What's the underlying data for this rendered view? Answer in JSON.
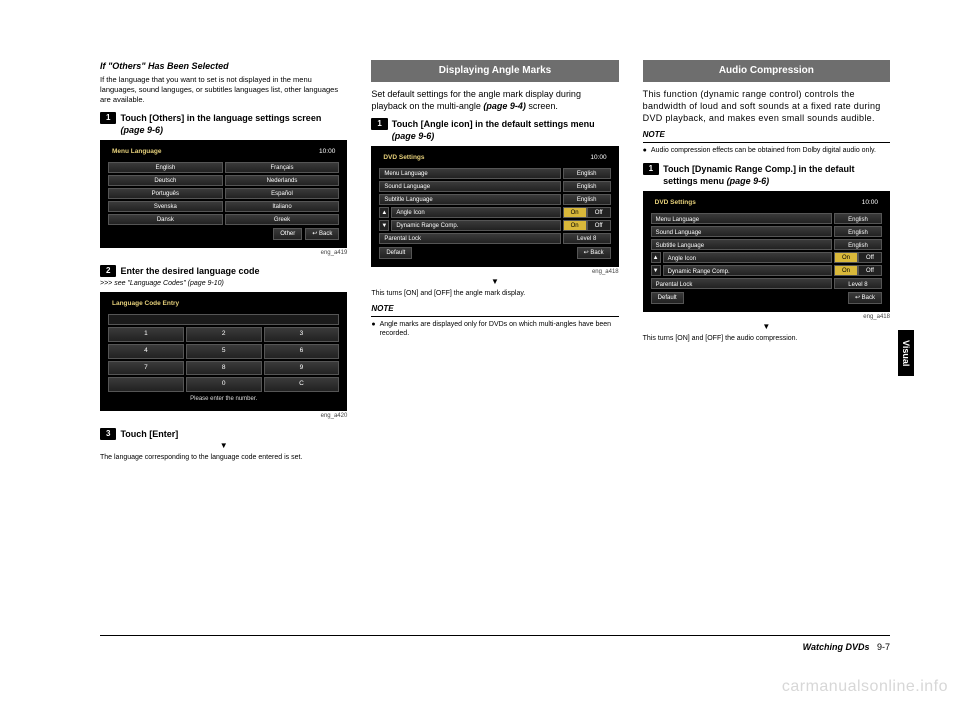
{
  "col1": {
    "subhead": "If \"Others\" Has Been Selected",
    "intro": "If the language that you want to set is not displayed in the menu languages, sound languges, or subtitles languages list, other languages are available.",
    "step1": "Touch [Others] in the language settings screen ",
    "step1_ref": "(page 9-6)",
    "shot1": {
      "title": "Menu Language",
      "time": "10:00",
      "opts": [
        "English",
        "Français",
        "Deutsch",
        "Nederlands",
        "Português",
        "Español",
        "Svenska",
        "Italiano",
        "Dansk",
        "Greek"
      ],
      "other": "Other",
      "back": "Back",
      "cap": "eng_a419"
    },
    "step2": "Enter the desired language code",
    "step2_xref": ">>> see \"Language Codes\" (page 9-10)",
    "shot2": {
      "title": "Language Code Entry",
      "keys": [
        "1",
        "2",
        "3",
        "4",
        "5",
        "6",
        "7",
        "8",
        "9",
        " ",
        "0",
        "C"
      ],
      "msg": "Please enter the number.",
      "cap": "eng_a420"
    },
    "step3": "Touch [Enter]",
    "result": "The language corresponding to the language code entered is set."
  },
  "col2": {
    "bar": "Displaying Angle Marks",
    "intro1": "Set default settings for the angle mark display during playback on the multi-angle ",
    "intro1_ref": "(page 9-4)",
    "intro1_tail": " screen.",
    "step1": "Touch [Angle icon] in the default settings menu ",
    "step1_ref": "(page 9-6)",
    "shot": {
      "title": "DVD Settings",
      "time": "10:00",
      "rows": [
        {
          "label": "Menu Language",
          "val": "English"
        },
        {
          "label": "Sound Language",
          "val": "English"
        },
        {
          "label": "Subtitle Language",
          "val": "English"
        },
        {
          "label": "Angle Icon",
          "on": "On",
          "off": "Off"
        },
        {
          "label": "Dynamic Range Comp.",
          "on": "On",
          "off": "Off"
        },
        {
          "label": "Parental Lock",
          "val": "Level 8"
        }
      ],
      "default": "Default",
      "back": "Back",
      "cap": "eng_a418"
    },
    "result": "This turns [ON] and [OFF] the angle mark display.",
    "note_head": "NOTE",
    "note": "Angle marks are displayed only for DVDs on which multi-angles have been recorded."
  },
  "col3": {
    "bar": "Audio Compression",
    "intro": "This function (dynamic range control) controls the bandwidth of loud and soft sounds at a fixed rate during DVD playback, and makes even small sounds audible.",
    "note_head": "NOTE",
    "note": "Audio compression effects can be obtained from Dolby digital audio only.",
    "step1": "Touch [Dynamic Range Comp.] in the default settings menu ",
    "step1_ref": "(page 9-6)",
    "shot": {
      "title": "DVD Settings",
      "time": "10:00",
      "rows": [
        {
          "label": "Menu Language",
          "val": "English"
        },
        {
          "label": "Sound Language",
          "val": "English"
        },
        {
          "label": "Subtitle Language",
          "val": "English"
        },
        {
          "label": "Angle Icon",
          "on": "On",
          "off": "Off"
        },
        {
          "label": "Dynamic Range Comp.",
          "on": "On",
          "off": "Off"
        },
        {
          "label": "Parental Lock",
          "val": "Level 8"
        }
      ],
      "default": "Default",
      "back": "Back",
      "cap": "eng_a418"
    },
    "result": "This turns [ON] and [OFF] the audio compression."
  },
  "footer": {
    "section": "Watching DVDs",
    "page": "9-7"
  },
  "sidetab": "Visual",
  "watermark": "carmanualsonline.info",
  "glyph": {
    "down": "▼",
    "back": "↩",
    "bullet": "●"
  }
}
